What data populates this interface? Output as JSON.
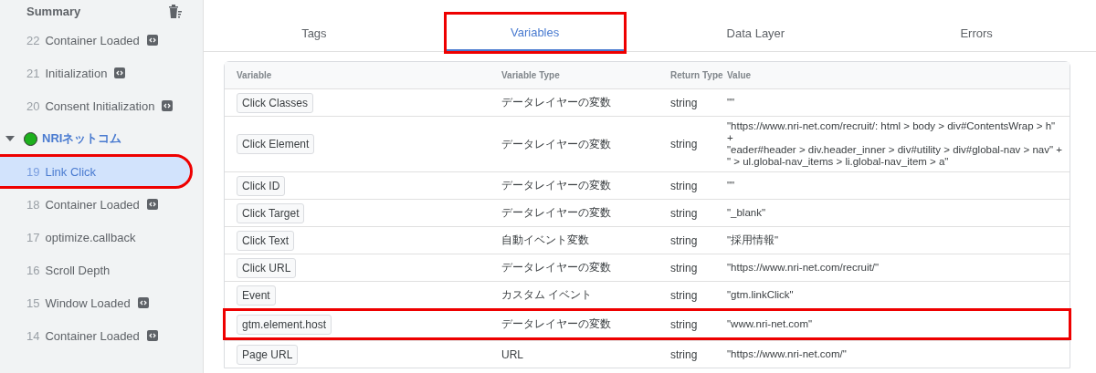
{
  "sidebar": {
    "summary": "Summary",
    "items": [
      {
        "kind": "event",
        "number": "22",
        "label": "Container Loaded",
        "code_badge": true,
        "selected": false,
        "highlighted": false
      },
      {
        "kind": "event",
        "number": "21",
        "label": "Initialization",
        "code_badge": true,
        "selected": false,
        "highlighted": false
      },
      {
        "kind": "event",
        "number": "20",
        "label": "Consent Initialization",
        "code_badge": true,
        "selected": false,
        "highlighted": false
      },
      {
        "kind": "group",
        "label": "NRIネットコム",
        "expanded": true,
        "color": "#1db01d"
      },
      {
        "kind": "event",
        "number": "19",
        "label": "Link Click",
        "code_badge": false,
        "selected": true,
        "highlighted": true
      },
      {
        "kind": "event",
        "number": "18",
        "label": "Container Loaded",
        "code_badge": true,
        "selected": false,
        "highlighted": false
      },
      {
        "kind": "event",
        "number": "17",
        "label": "optimize.callback",
        "code_badge": false,
        "selected": false,
        "highlighted": false
      },
      {
        "kind": "event",
        "number": "16",
        "label": "Scroll Depth",
        "code_badge": false,
        "selected": false,
        "highlighted": false
      },
      {
        "kind": "event",
        "number": "15",
        "label": "Window Loaded",
        "code_badge": true,
        "selected": false,
        "highlighted": false
      },
      {
        "kind": "event",
        "number": "14",
        "label": "Container Loaded",
        "code_badge": true,
        "selected": false,
        "highlighted": false
      }
    ]
  },
  "tabs": [
    {
      "label": "Tags",
      "selected": false,
      "highlighted": false
    },
    {
      "label": "Variables",
      "selected": true,
      "highlighted": true
    },
    {
      "label": "Data Layer",
      "selected": false,
      "highlighted": false
    },
    {
      "label": "Errors",
      "selected": false,
      "highlighted": false
    }
  ],
  "table": {
    "columns": [
      "Variable",
      "Variable Type",
      "Return Type",
      "Value"
    ],
    "rows": [
      {
        "variable": "Click Classes",
        "type": "データレイヤーの変数",
        "return_type": "string",
        "value": [
          "\"\""
        ],
        "highlighted": false
      },
      {
        "variable": "Click Element",
        "type": "データレイヤーの変数",
        "return_type": "string",
        "value": [
          "\"https://www.nri-net.com/recruit/: html > body > div#ContentsWrap > h\" +",
          "\"eader#header > div.header_inner > div#utility > div#global-nav > nav\" +",
          "\" > ul.global-nav_items > li.global-nav_item > a\""
        ],
        "highlighted": false
      },
      {
        "variable": "Click ID",
        "type": "データレイヤーの変数",
        "return_type": "string",
        "value": [
          "\"\""
        ],
        "highlighted": false
      },
      {
        "variable": "Click Target",
        "type": "データレイヤーの変数",
        "return_type": "string",
        "value": [
          "\"_blank\""
        ],
        "highlighted": false
      },
      {
        "variable": "Click Text",
        "type": "自動イベント変数",
        "return_type": "string",
        "value": [
          "\"採用情報\""
        ],
        "highlighted": false
      },
      {
        "variable": "Click URL",
        "type": "データレイヤーの変数",
        "return_type": "string",
        "value": [
          "\"https://www.nri-net.com/recruit/\""
        ],
        "highlighted": false
      },
      {
        "variable": "Event",
        "type": "カスタム イベント",
        "return_type": "string",
        "value": [
          "\"gtm.linkClick\""
        ],
        "highlighted": false
      },
      {
        "variable": "gtm.element.host",
        "type": "データレイヤーの変数",
        "return_type": "string",
        "value": [
          "\"www.nri-net.com\""
        ],
        "highlighted": true
      },
      {
        "variable": "Page URL",
        "type": "URL",
        "return_type": "string",
        "value": [
          "\"https://www.nri-net.com/\""
        ],
        "highlighted": false
      }
    ]
  }
}
